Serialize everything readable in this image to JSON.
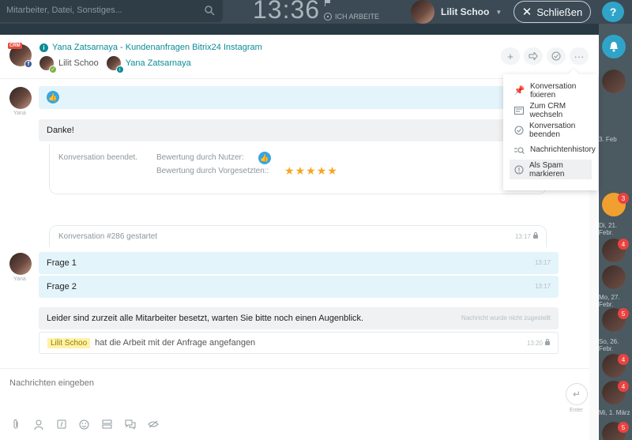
{
  "topbar": {
    "search_placeholder": "Mitarbeiter, Datei, Sonstiges...",
    "clock": "13:36",
    "work_status": "ICH ARBEITE",
    "user_name": "Lilit Schoo",
    "close_label": "Schließen",
    "help_label": "?"
  },
  "header": {
    "crm_tag": "CRM",
    "title": "Yana Zatsarnaya - Kundenanfragen Bitrix24 Instagram",
    "members": [
      {
        "name": "Lilit Schoo"
      },
      {
        "name": "Yana Zatsarnaya"
      }
    ],
    "actions": [
      "add",
      "forward",
      "finish",
      "more"
    ]
  },
  "menu": {
    "items": [
      {
        "label": "Konversation fixieren",
        "icon": "pin-icon"
      },
      {
        "label": "Zum CRM wechseln",
        "icon": "crm-icon"
      },
      {
        "label": "Konversation beenden",
        "icon": "check-circle-icon"
      },
      {
        "label": "Nachrichtenhistory",
        "icon": "history-search-icon"
      },
      {
        "label": "Als Spam markieren",
        "icon": "spam-icon"
      }
    ]
  },
  "messages": {
    "author_short": "Yana",
    "danke": "Danke!",
    "ended": "Konversation beendet.",
    "rating_user": "Bewertung durch Nutzer:",
    "rating_supervisor": "Bewertung durch Vorgesetzten::",
    "stars": 5,
    "started": "Konversation #286 gestartet",
    "started_time": "13:17",
    "frage1": "Frage 1",
    "frage1_time": "13:17",
    "frage2": "Frage 2",
    "frage2_time": "13:17",
    "busy": "Leider sind zurzeit alle Mitarbeiter besetzt, warten Sie bitte noch einen Augenblick.",
    "busy_status": "Nachricht wurde nicht zugestellt",
    "agent_tag": "Lilit Schoo",
    "agent_action": "hat die Arbeit mit der Anfrage angefangen",
    "agent_time": "13:20"
  },
  "input": {
    "placeholder": "Nachrichten eingeben",
    "enter_label": "Enter"
  },
  "right_strip": {
    "badges": [
      "3",
      "4",
      "5",
      "4",
      "4",
      "4",
      "5"
    ],
    "dates": [
      "3. Feb",
      "Di, 21. Febr.",
      "Mo, 27. Febr.",
      "So, 26. Febr.",
      "Fr, 24. Febr.",
      "Mi, 1. März"
    ]
  },
  "colors": {
    "accent": "#0b8c96",
    "bubble": "#e4f4fb",
    "star": "#f5a623",
    "like": "#3aa5e0"
  }
}
